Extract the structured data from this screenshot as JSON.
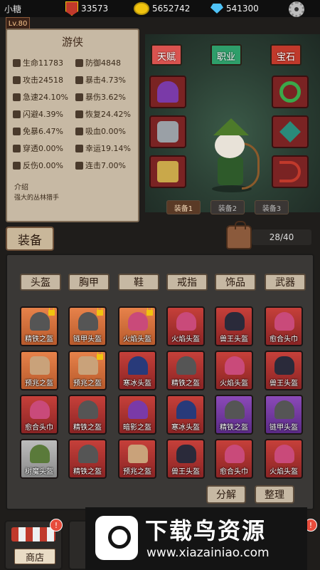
{
  "header": {
    "player_name": "小糖",
    "rank_points": "33573",
    "coins": "5652742",
    "gems": "541300",
    "icons": {
      "rank": "rank-shield-icon",
      "coin": "gold-coin-icon",
      "gem": "diamond-icon",
      "settings": "gear-icon"
    }
  },
  "level": "Lv.80",
  "stats": {
    "class_title": "游侠",
    "rows": [
      [
        {
          "label": "生命",
          "value": "11783",
          "icon": "heart-icon"
        },
        {
          "label": "防御",
          "value": "4848",
          "icon": "shield-icon"
        }
      ],
      [
        {
          "label": "攻击",
          "value": "24518",
          "icon": "sword-icon"
        },
        {
          "label": "暴击",
          "value": "4.73%",
          "icon": "crit-icon"
        }
      ],
      [
        {
          "label": "急速",
          "value": "24.10%",
          "icon": "speed-icon"
        },
        {
          "label": "暴伤",
          "value": "3.62%",
          "icon": "crit-damage-icon"
        }
      ],
      [
        {
          "label": "闪避",
          "value": "4.39%",
          "icon": "dodge-icon"
        },
        {
          "label": "恢复",
          "value": "24.42%",
          "icon": "regen-icon"
        }
      ],
      [
        {
          "label": "免暴",
          "value": "6.47%",
          "icon": "crit-resist-icon"
        },
        {
          "label": "吸血",
          "value": "0.00%",
          "icon": "lifesteal-icon"
        }
      ],
      [
        {
          "label": "穿透",
          "value": "0.00%",
          "icon": "penetration-icon"
        },
        {
          "label": "幸运",
          "value": "19.14%",
          "icon": "luck-icon"
        }
      ],
      [
        {
          "label": "反伤",
          "value": "0.00%",
          "icon": "reflect-icon"
        },
        {
          "label": "连击",
          "value": "7.00%",
          "icon": "combo-icon"
        }
      ]
    ],
    "intro_label": "介绍",
    "intro_text": "强大的丛林猎手"
  },
  "character_tabs": [
    {
      "label": "天赋",
      "color": "#d9534f"
    },
    {
      "label": "职业",
      "color": "#2e9e6a"
    },
    {
      "label": "宝石",
      "color": "#c0392b"
    }
  ],
  "presets": [
    "装备1",
    "装备2",
    "装备3"
  ],
  "equip_section": {
    "title": "装备",
    "bag_count": "28/40"
  },
  "categories": [
    "头盔",
    "胸甲",
    "鞋",
    "戒指",
    "饰品",
    "武器"
  ],
  "items": [
    {
      "name": "精铁之盔",
      "rarity": "orange",
      "art": "helm",
      "locked": true
    },
    {
      "name": "链甲头盔",
      "rarity": "orange",
      "art": "helm",
      "locked": true
    },
    {
      "name": "火焰头盔",
      "rarity": "orange",
      "art": "hood",
      "locked": true
    },
    {
      "name": "火焰头盔",
      "rarity": "red",
      "art": "hood",
      "locked": false
    },
    {
      "name": "兽王头盔",
      "rarity": "red",
      "art": "beast",
      "locked": false
    },
    {
      "name": "愈合头巾",
      "rarity": "red",
      "art": "hood",
      "locked": false
    },
    {
      "name": "预兆之盔",
      "rarity": "orange",
      "art": "boot",
      "locked": false
    },
    {
      "name": "预兆之盔",
      "rarity": "orange",
      "art": "boot",
      "locked": true
    },
    {
      "name": "寒冰头盔",
      "rarity": "red",
      "art": "hat",
      "locked": false
    },
    {
      "name": "精铁之盔",
      "rarity": "red",
      "art": "helm",
      "locked": false
    },
    {
      "name": "火焰头盔",
      "rarity": "red",
      "art": "hood",
      "locked": false
    },
    {
      "name": "兽王头盔",
      "rarity": "red",
      "art": "beast",
      "locked": false
    },
    {
      "name": "愈合头巾",
      "rarity": "red",
      "art": "hood",
      "locked": false
    },
    {
      "name": "精铁之盔",
      "rarity": "red",
      "art": "helm",
      "locked": false
    },
    {
      "name": "暗影之盔",
      "rarity": "red",
      "art": "purple",
      "locked": false
    },
    {
      "name": "寒冰头盔",
      "rarity": "red",
      "art": "hat",
      "locked": false
    },
    {
      "name": "精铁之盔",
      "rarity": "purple",
      "art": "helm",
      "locked": false
    },
    {
      "name": "链甲头盔",
      "rarity": "purple",
      "art": "helm",
      "locked": false
    },
    {
      "name": "树魔头盔",
      "rarity": "grey",
      "art": "green",
      "locked": false
    },
    {
      "name": "精铁之盔",
      "rarity": "red",
      "art": "helm",
      "locked": false
    },
    {
      "name": "预兆之盔",
      "rarity": "red",
      "art": "boot",
      "locked": false
    },
    {
      "name": "兽王头盔",
      "rarity": "red",
      "art": "beast",
      "locked": false
    },
    {
      "name": "愈合头巾",
      "rarity": "red",
      "art": "hood",
      "locked": false
    },
    {
      "name": "火焰头盔",
      "rarity": "red",
      "art": "hood",
      "locked": false
    }
  ],
  "actions": {
    "disassemble": "分解",
    "sort": "整理"
  },
  "bottom_nav": {
    "shop": "商店",
    "badge": "!"
  },
  "watermark": {
    "title": "下载鸟资源",
    "url": "www.xiazainiao.com"
  }
}
